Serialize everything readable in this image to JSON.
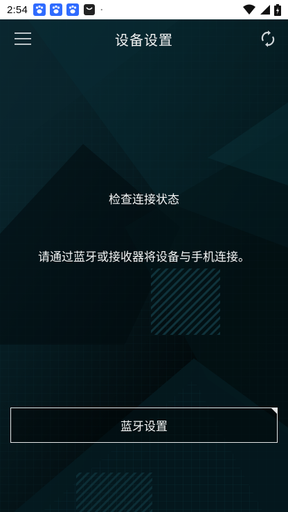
{
  "status_bar": {
    "time": "2:54",
    "notification_icons": [
      "baidu-paw-icon",
      "baidu-paw-icon",
      "baidu-paw-icon",
      "shopping-bag-icon",
      "dot-icon"
    ],
    "right_icons": [
      "wifi-icon",
      "cell-signal-icon",
      "battery-charging-icon"
    ]
  },
  "header": {
    "title": "设备设置",
    "left_icon": "menu-icon",
    "right_icon": "sync-icon"
  },
  "main": {
    "heading": "检查连接状态",
    "message": "请通过蓝牙或接收器将设备与手机连接。"
  },
  "bluetooth_button": {
    "label": "蓝牙设置"
  },
  "colors": {
    "accent_teal": "#2c7f8e",
    "background": "#020506",
    "text": "#f4f4f4"
  }
}
